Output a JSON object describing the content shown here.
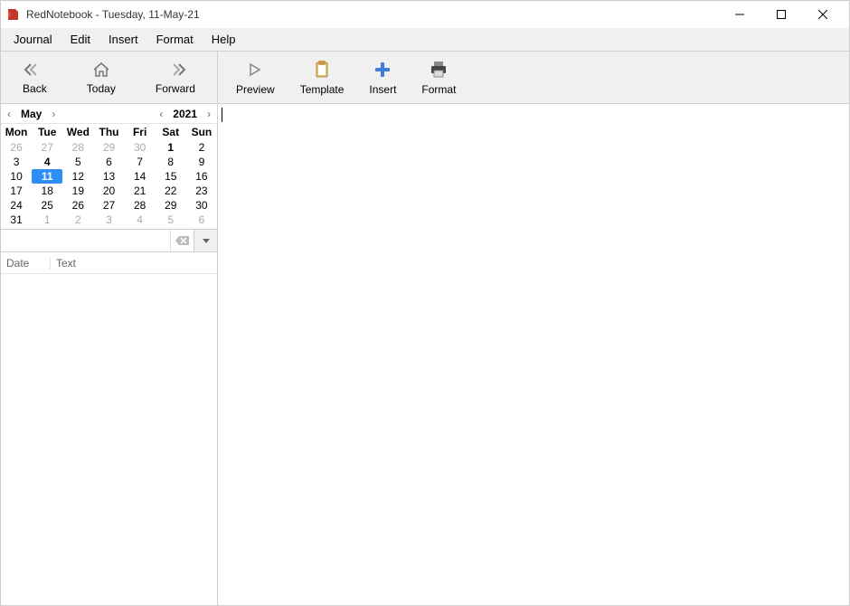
{
  "window": {
    "title": "RedNotebook - Tuesday, 11-May-21"
  },
  "menubar": {
    "items": [
      "Journal",
      "Edit",
      "Insert",
      "Format",
      "Help"
    ]
  },
  "nav": {
    "back": "Back",
    "today": "Today",
    "forward": "Forward"
  },
  "toolbar": {
    "preview": "Preview",
    "template": "Template",
    "insert": "Insert",
    "format": "Format"
  },
  "calendar": {
    "month": "May",
    "year": "2021",
    "dow": [
      "Mon",
      "Tue",
      "Wed",
      "Thu",
      "Fri",
      "Sat",
      "Sun"
    ],
    "weeks": [
      [
        {
          "d": "26",
          "out": true
        },
        {
          "d": "27",
          "out": true
        },
        {
          "d": "28",
          "out": true
        },
        {
          "d": "29",
          "out": true
        },
        {
          "d": "30",
          "out": true
        },
        {
          "d": "1",
          "bold": true
        },
        {
          "d": "2"
        }
      ],
      [
        {
          "d": "3"
        },
        {
          "d": "4",
          "bold": true
        },
        {
          "d": "5"
        },
        {
          "d": "6"
        },
        {
          "d": "7"
        },
        {
          "d": "8"
        },
        {
          "d": "9"
        }
      ],
      [
        {
          "d": "10"
        },
        {
          "d": "11",
          "sel": true,
          "bold": true
        },
        {
          "d": "12"
        },
        {
          "d": "13"
        },
        {
          "d": "14"
        },
        {
          "d": "15"
        },
        {
          "d": "16"
        }
      ],
      [
        {
          "d": "17"
        },
        {
          "d": "18"
        },
        {
          "d": "19"
        },
        {
          "d": "20"
        },
        {
          "d": "21"
        },
        {
          "d": "22"
        },
        {
          "d": "23"
        }
      ],
      [
        {
          "d": "24"
        },
        {
          "d": "25"
        },
        {
          "d": "26"
        },
        {
          "d": "27"
        },
        {
          "d": "28"
        },
        {
          "d": "29"
        },
        {
          "d": "30"
        }
      ],
      [
        {
          "d": "31"
        },
        {
          "d": "1",
          "out": true
        },
        {
          "d": "2",
          "out": true
        },
        {
          "d": "3",
          "out": true
        },
        {
          "d": "4",
          "out": true
        },
        {
          "d": "5",
          "out": true
        },
        {
          "d": "6",
          "out": true
        }
      ]
    ]
  },
  "search": {
    "placeholder": ""
  },
  "results": {
    "cols": {
      "date": "Date",
      "text": "Text"
    }
  }
}
